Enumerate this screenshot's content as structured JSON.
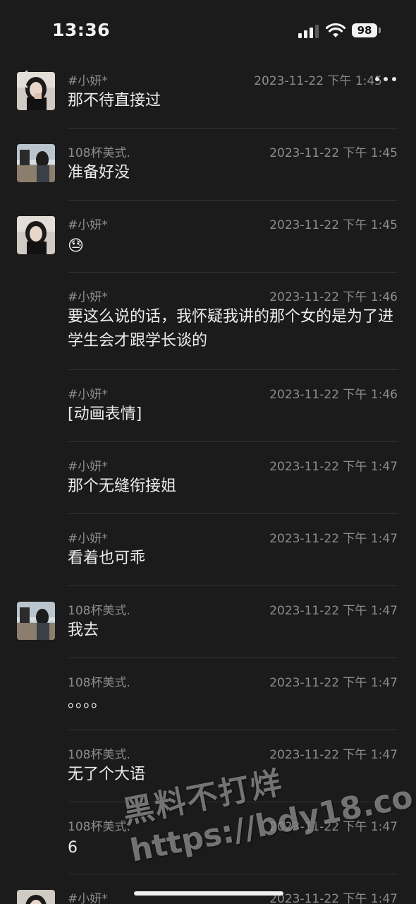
{
  "status_bar": {
    "time": "13:36",
    "battery": "98"
  },
  "icons": {
    "back": "chevron-left-icon",
    "more": "ellipsis-icon"
  },
  "messages": [
    {
      "sender": "#小妍*",
      "time": "2023-11-22 下午 1:45",
      "text": "那不待直接过",
      "avatar": "girl"
    },
    {
      "sender": "108杯美式.",
      "time": "2023-11-22 下午 1:45",
      "text": "准备好没",
      "avatar": "scene"
    },
    {
      "sender": "#小妍*",
      "time": "2023-11-22 下午 1:45",
      "text": "😓",
      "avatar": "girl"
    },
    {
      "sender": "#小妍*",
      "time": "2023-11-22 下午 1:46",
      "text": "要这么说的话，我怀疑我讲的那个女的是为了进学生会才跟学长谈的",
      "avatar": ""
    },
    {
      "sender": "#小妍*",
      "time": "2023-11-22 下午 1:46",
      "text": "[动画表情]",
      "avatar": ""
    },
    {
      "sender": "#小妍*",
      "time": "2023-11-22 下午 1:47",
      "text": "那个无缝衔接姐",
      "avatar": ""
    },
    {
      "sender": "#小妍*",
      "time": "2023-11-22 下午 1:47",
      "text": "看着也可乖",
      "avatar": ""
    },
    {
      "sender": "108杯美式.",
      "time": "2023-11-22 下午 1:47",
      "text": "我去",
      "avatar": "scene"
    },
    {
      "sender": "108杯美式.",
      "time": "2023-11-22 下午 1:47",
      "text": "。。。。",
      "avatar": ""
    },
    {
      "sender": "108杯美式.",
      "time": "2023-11-22 下午 1:47",
      "text": "无了个大语",
      "avatar": ""
    },
    {
      "sender": "108杯美式.",
      "time": "2023-11-22 下午 1:47",
      "text": "6",
      "avatar": ""
    },
    {
      "sender": "#小妍*",
      "time": "2023-11-22 下午 1:47",
      "text": "",
      "avatar": "girl"
    }
  ],
  "watermark": {
    "line1": "黑料不打烊",
    "line2": "https://bdy18.co"
  }
}
